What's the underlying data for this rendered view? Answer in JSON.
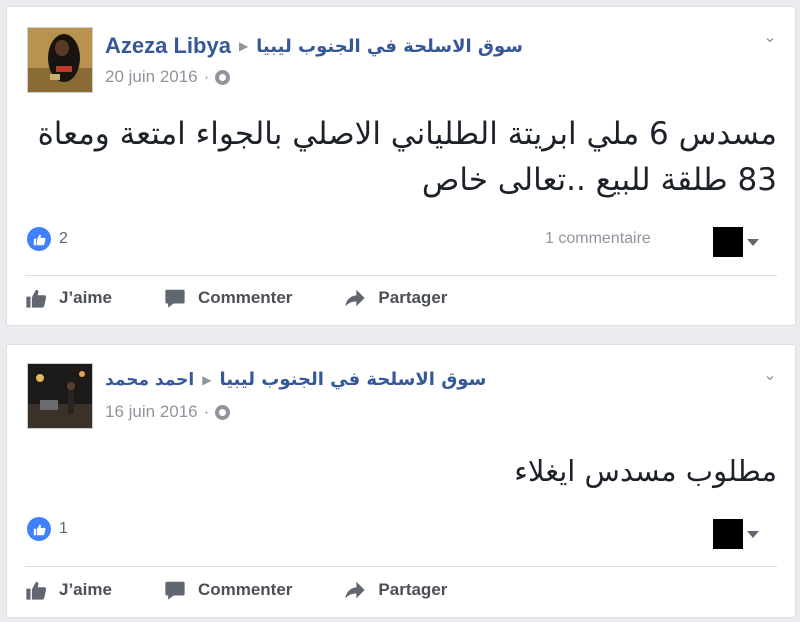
{
  "colors": {
    "link": "#365899",
    "like_blue": "#4080ff",
    "meta": "#90949c"
  },
  "icons": {
    "like_badge": "thumbs-up-icon",
    "like": "thumbs-up-icon",
    "comment": "speech-bubble-icon",
    "share": "share-arrow-icon",
    "privacy": "globe-icon",
    "menu": "chevron-down-icon"
  },
  "posts": [
    {
      "author": "Azeza Libya",
      "group": "سوق الاسلحة في الجنوب ليبيا",
      "date": "20 juin 2016",
      "separator": "·",
      "text": "مسدس 6 ملي ابريتة الطلياني الاصلي بالجواء امتعة ومعاة 83 طلقة للبيع ..تعالى خاص",
      "likes": "2",
      "comments": "1 commentaire",
      "actions": {
        "like": "J’aime",
        "comment": "Commenter",
        "share": "Partager"
      }
    },
    {
      "author": "احمد محمد",
      "group": "سوق الاسلحة في الجنوب ليبيا",
      "date": "16 juin 2016",
      "separator": "·",
      "text": "مطلوب مسدس ايغلاء",
      "likes": "1",
      "actions": {
        "like": "J’aime",
        "comment": "Commenter",
        "share": "Partager"
      }
    }
  ]
}
